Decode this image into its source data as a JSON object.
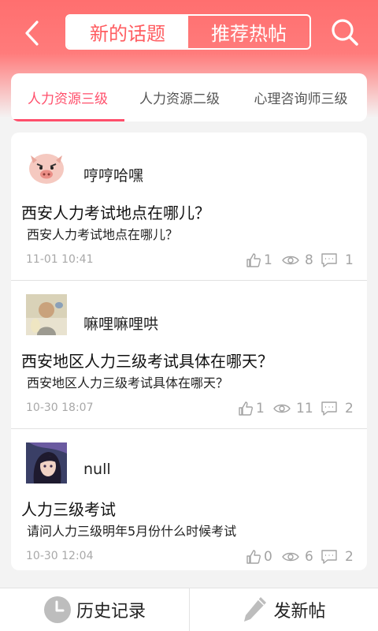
{
  "header": {
    "back_icon": "chevron-left-icon",
    "segments": [
      "新的话题",
      "推荐热帖"
    ],
    "search_icon": "search-icon"
  },
  "tabs": [
    "人力资源三级",
    "人力资源二级",
    "心理咨询师三级"
  ],
  "posts": [
    {
      "user": "哼哼哈嘿",
      "avatar": "pig-avatar",
      "title": "西安人力考试地点在哪儿？",
      "body": "西安人力考试地点在哪儿？",
      "time": "11-01 10:41",
      "likes": "1",
      "views": "8",
      "comments": "1"
    },
    {
      "user": "嘛哩嘛哩哄",
      "avatar": "photo-avatar",
      "title": "西安地区人力三级考试具体在哪天？",
      "body": "西安地区人力三级考试具体在哪天？",
      "time": "10-30 18:07",
      "likes": "1",
      "views": "11",
      "comments": "2"
    },
    {
      "user": "null",
      "avatar": "anime-avatar",
      "title": "人力三级考试",
      "body": "请问人力三级明年5月份什么时候考试",
      "time": "10-30 12:04",
      "likes": "0",
      "views": "6",
      "comments": "2"
    }
  ],
  "bottom": {
    "history_label": "历史记录",
    "history_icon": "clock-icon",
    "new_post_label": "发新帖",
    "new_post_icon": "pencil-icon"
  },
  "colors": {
    "accent": "#ff5d61",
    "tab_active": "#ff4f6b"
  }
}
